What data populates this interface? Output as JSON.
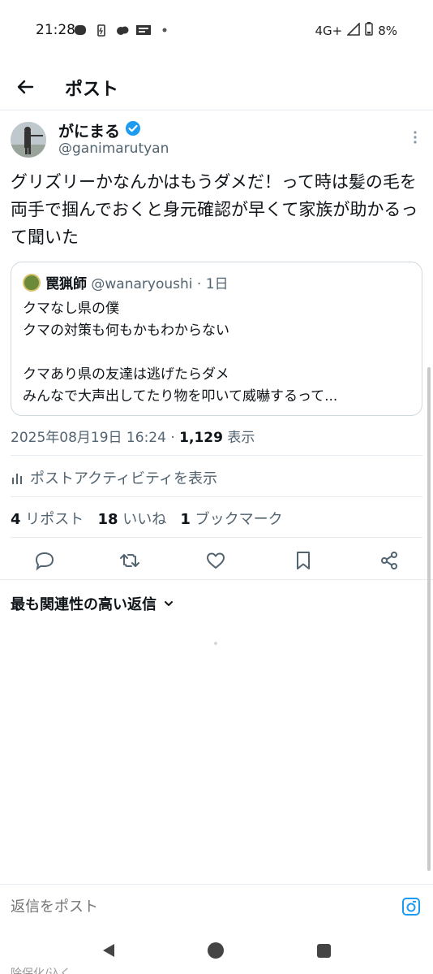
{
  "status_bar": {
    "time": "21:28",
    "network": "4G+",
    "battery": "8%"
  },
  "header": {
    "title": "ポスト"
  },
  "post": {
    "author_name": "がにまる",
    "author_handle": "@ganimarutyan",
    "text": "グリズリーかなんかはもうダメだ！って時は髪の毛を両手で掴んでおくと身元確認が早くて家族が助かるって聞いた",
    "timestamp": "2025年08月19日 16:24",
    "separator": " · ",
    "view_count": "1,129",
    "view_label": "表示"
  },
  "quote": {
    "author_name": "罠猟師",
    "author_handle": "@wanaryoushi",
    "age": "· 1日",
    "text": "クマなし県の僕\nクマの対策も何もかもわからない\n\nクマあり県の友達は逃げたらダメ\nみんなで大声出してたり物を叩いて威嚇するって..."
  },
  "activity": {
    "label": "ポストアクティビティを表示"
  },
  "stats": {
    "reposts_count": "4",
    "reposts_label": "リポスト",
    "likes_count": "18",
    "likes_label": "いいね",
    "bookmarks_count": "1",
    "bookmarks_label": "ブックマーク"
  },
  "replies": {
    "sort_label": "最も関連性の高い返信"
  },
  "composer": {
    "placeholder": "返信をポスト"
  },
  "nav_peek": "除保化/込く",
  "colors": {
    "verified": "#1d9bf0",
    "secondary_text": "#536471",
    "border": "#cfd9de"
  }
}
